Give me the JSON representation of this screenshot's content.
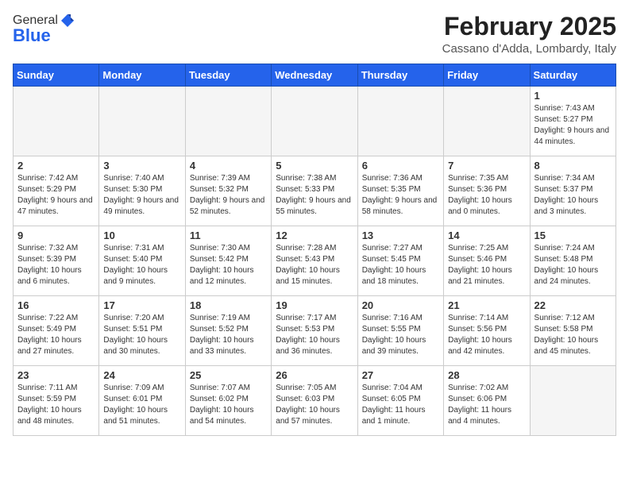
{
  "header": {
    "logo_general": "General",
    "logo_blue": "Blue",
    "month_year": "February 2025",
    "location": "Cassano d'Adda, Lombardy, Italy"
  },
  "weekdays": [
    "Sunday",
    "Monday",
    "Tuesday",
    "Wednesday",
    "Thursday",
    "Friday",
    "Saturday"
  ],
  "weeks": [
    [
      {
        "day": "",
        "info": ""
      },
      {
        "day": "",
        "info": ""
      },
      {
        "day": "",
        "info": ""
      },
      {
        "day": "",
        "info": ""
      },
      {
        "day": "",
        "info": ""
      },
      {
        "day": "",
        "info": ""
      },
      {
        "day": "1",
        "info": "Sunrise: 7:43 AM\nSunset: 5:27 PM\nDaylight: 9 hours and 44 minutes."
      }
    ],
    [
      {
        "day": "2",
        "info": "Sunrise: 7:42 AM\nSunset: 5:29 PM\nDaylight: 9 hours and 47 minutes."
      },
      {
        "day": "3",
        "info": "Sunrise: 7:40 AM\nSunset: 5:30 PM\nDaylight: 9 hours and 49 minutes."
      },
      {
        "day": "4",
        "info": "Sunrise: 7:39 AM\nSunset: 5:32 PM\nDaylight: 9 hours and 52 minutes."
      },
      {
        "day": "5",
        "info": "Sunrise: 7:38 AM\nSunset: 5:33 PM\nDaylight: 9 hours and 55 minutes."
      },
      {
        "day": "6",
        "info": "Sunrise: 7:36 AM\nSunset: 5:35 PM\nDaylight: 9 hours and 58 minutes."
      },
      {
        "day": "7",
        "info": "Sunrise: 7:35 AM\nSunset: 5:36 PM\nDaylight: 10 hours and 0 minutes."
      },
      {
        "day": "8",
        "info": "Sunrise: 7:34 AM\nSunset: 5:37 PM\nDaylight: 10 hours and 3 minutes."
      }
    ],
    [
      {
        "day": "9",
        "info": "Sunrise: 7:32 AM\nSunset: 5:39 PM\nDaylight: 10 hours and 6 minutes."
      },
      {
        "day": "10",
        "info": "Sunrise: 7:31 AM\nSunset: 5:40 PM\nDaylight: 10 hours and 9 minutes."
      },
      {
        "day": "11",
        "info": "Sunrise: 7:30 AM\nSunset: 5:42 PM\nDaylight: 10 hours and 12 minutes."
      },
      {
        "day": "12",
        "info": "Sunrise: 7:28 AM\nSunset: 5:43 PM\nDaylight: 10 hours and 15 minutes."
      },
      {
        "day": "13",
        "info": "Sunrise: 7:27 AM\nSunset: 5:45 PM\nDaylight: 10 hours and 18 minutes."
      },
      {
        "day": "14",
        "info": "Sunrise: 7:25 AM\nSunset: 5:46 PM\nDaylight: 10 hours and 21 minutes."
      },
      {
        "day": "15",
        "info": "Sunrise: 7:24 AM\nSunset: 5:48 PM\nDaylight: 10 hours and 24 minutes."
      }
    ],
    [
      {
        "day": "16",
        "info": "Sunrise: 7:22 AM\nSunset: 5:49 PM\nDaylight: 10 hours and 27 minutes."
      },
      {
        "day": "17",
        "info": "Sunrise: 7:20 AM\nSunset: 5:51 PM\nDaylight: 10 hours and 30 minutes."
      },
      {
        "day": "18",
        "info": "Sunrise: 7:19 AM\nSunset: 5:52 PM\nDaylight: 10 hours and 33 minutes."
      },
      {
        "day": "19",
        "info": "Sunrise: 7:17 AM\nSunset: 5:53 PM\nDaylight: 10 hours and 36 minutes."
      },
      {
        "day": "20",
        "info": "Sunrise: 7:16 AM\nSunset: 5:55 PM\nDaylight: 10 hours and 39 minutes."
      },
      {
        "day": "21",
        "info": "Sunrise: 7:14 AM\nSunset: 5:56 PM\nDaylight: 10 hours and 42 minutes."
      },
      {
        "day": "22",
        "info": "Sunrise: 7:12 AM\nSunset: 5:58 PM\nDaylight: 10 hours and 45 minutes."
      }
    ],
    [
      {
        "day": "23",
        "info": "Sunrise: 7:11 AM\nSunset: 5:59 PM\nDaylight: 10 hours and 48 minutes."
      },
      {
        "day": "24",
        "info": "Sunrise: 7:09 AM\nSunset: 6:01 PM\nDaylight: 10 hours and 51 minutes."
      },
      {
        "day": "25",
        "info": "Sunrise: 7:07 AM\nSunset: 6:02 PM\nDaylight: 10 hours and 54 minutes."
      },
      {
        "day": "26",
        "info": "Sunrise: 7:05 AM\nSunset: 6:03 PM\nDaylight: 10 hours and 57 minutes."
      },
      {
        "day": "27",
        "info": "Sunrise: 7:04 AM\nSunset: 6:05 PM\nDaylight: 11 hours and 1 minute."
      },
      {
        "day": "28",
        "info": "Sunrise: 7:02 AM\nSunset: 6:06 PM\nDaylight: 11 hours and 4 minutes."
      },
      {
        "day": "",
        "info": ""
      }
    ]
  ]
}
